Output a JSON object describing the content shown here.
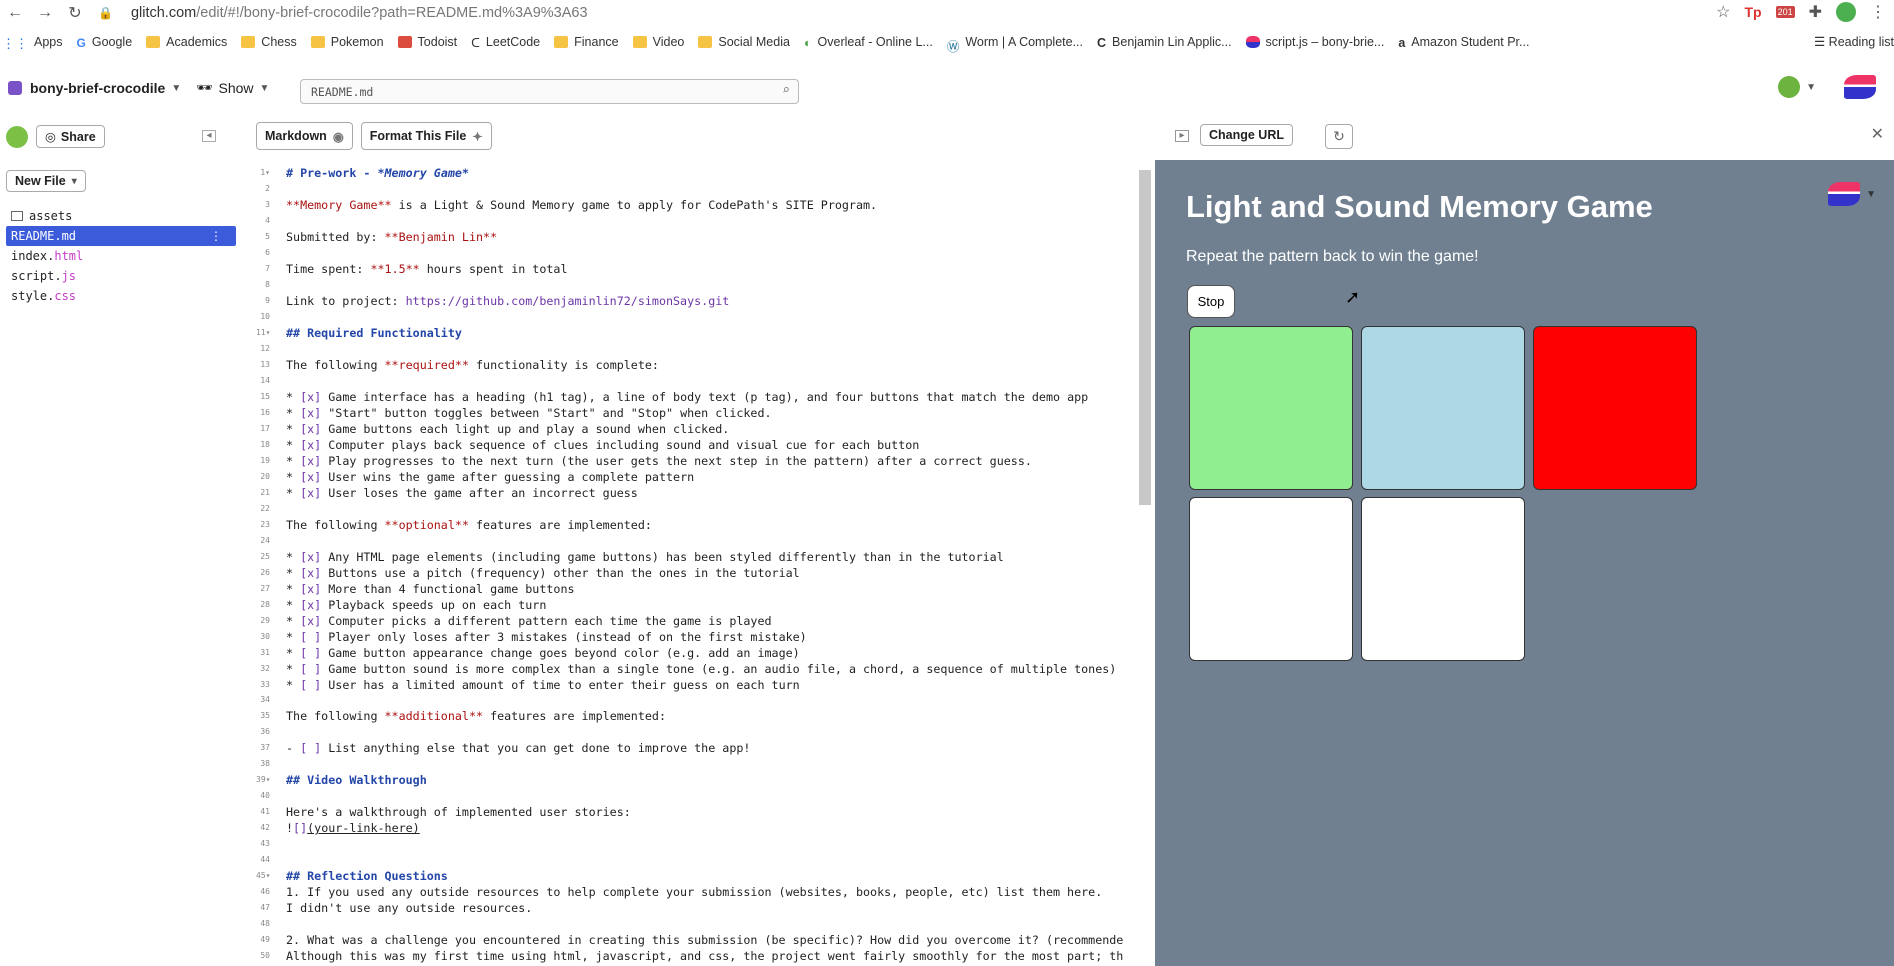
{
  "browser": {
    "url_host": "glitch.com",
    "url_path": "/edit/#!/bony-brief-crocodile?path=README.md%3A9%3A63",
    "ext_tp": "Tp",
    "ext_cal": "201",
    "bookmarks": [
      {
        "label": "Apps",
        "type": "apps"
      },
      {
        "label": "Google",
        "type": "site"
      },
      {
        "label": "Academics",
        "type": "folder"
      },
      {
        "label": "Chess",
        "type": "folder"
      },
      {
        "label": "Pokemon",
        "type": "folder"
      },
      {
        "label": "Todoist",
        "type": "site"
      },
      {
        "label": "LeetCode",
        "type": "site"
      },
      {
        "label": "Finance",
        "type": "folder"
      },
      {
        "label": "Video",
        "type": "folder"
      },
      {
        "label": "Social Media",
        "type": "folder"
      },
      {
        "label": "Overleaf - Online L...",
        "type": "site"
      },
      {
        "label": "Worm | A Complete...",
        "type": "site"
      },
      {
        "label": "Benjamin Lin Applic...",
        "type": "site"
      },
      {
        "label": "script.js – bony-brie...",
        "type": "site"
      },
      {
        "label": "Amazon Student Pr...",
        "type": "site"
      }
    ],
    "reading_list": "Reading list"
  },
  "header": {
    "project_name": "bony-brief-crocodile",
    "show_label": "Show",
    "search_value": "README.md"
  },
  "sidebar": {
    "share_label": "Share",
    "new_file_label": "New File",
    "files": [
      {
        "name": "assets",
        "ext": "",
        "kind": "folder"
      },
      {
        "name": "README.md",
        "ext": "",
        "kind": "file",
        "active": true
      },
      {
        "name": "index.",
        "ext": "html",
        "kind": "file"
      },
      {
        "name": "script.",
        "ext": "js",
        "kind": "file"
      },
      {
        "name": "style.",
        "ext": "css",
        "kind": "file"
      }
    ]
  },
  "editor": {
    "markdown_label": "Markdown",
    "format_label": "Format This File"
  },
  "preview": {
    "change_url_label": "Change URL",
    "title": "Light and Sound Memory Game",
    "subtitle": "Repeat the pattern back to win the game!",
    "stop_label": "Stop",
    "button_colors": [
      "#90ee90",
      "#add8e6",
      "#ff0000",
      "#ffffff",
      "#ffffff"
    ]
  }
}
